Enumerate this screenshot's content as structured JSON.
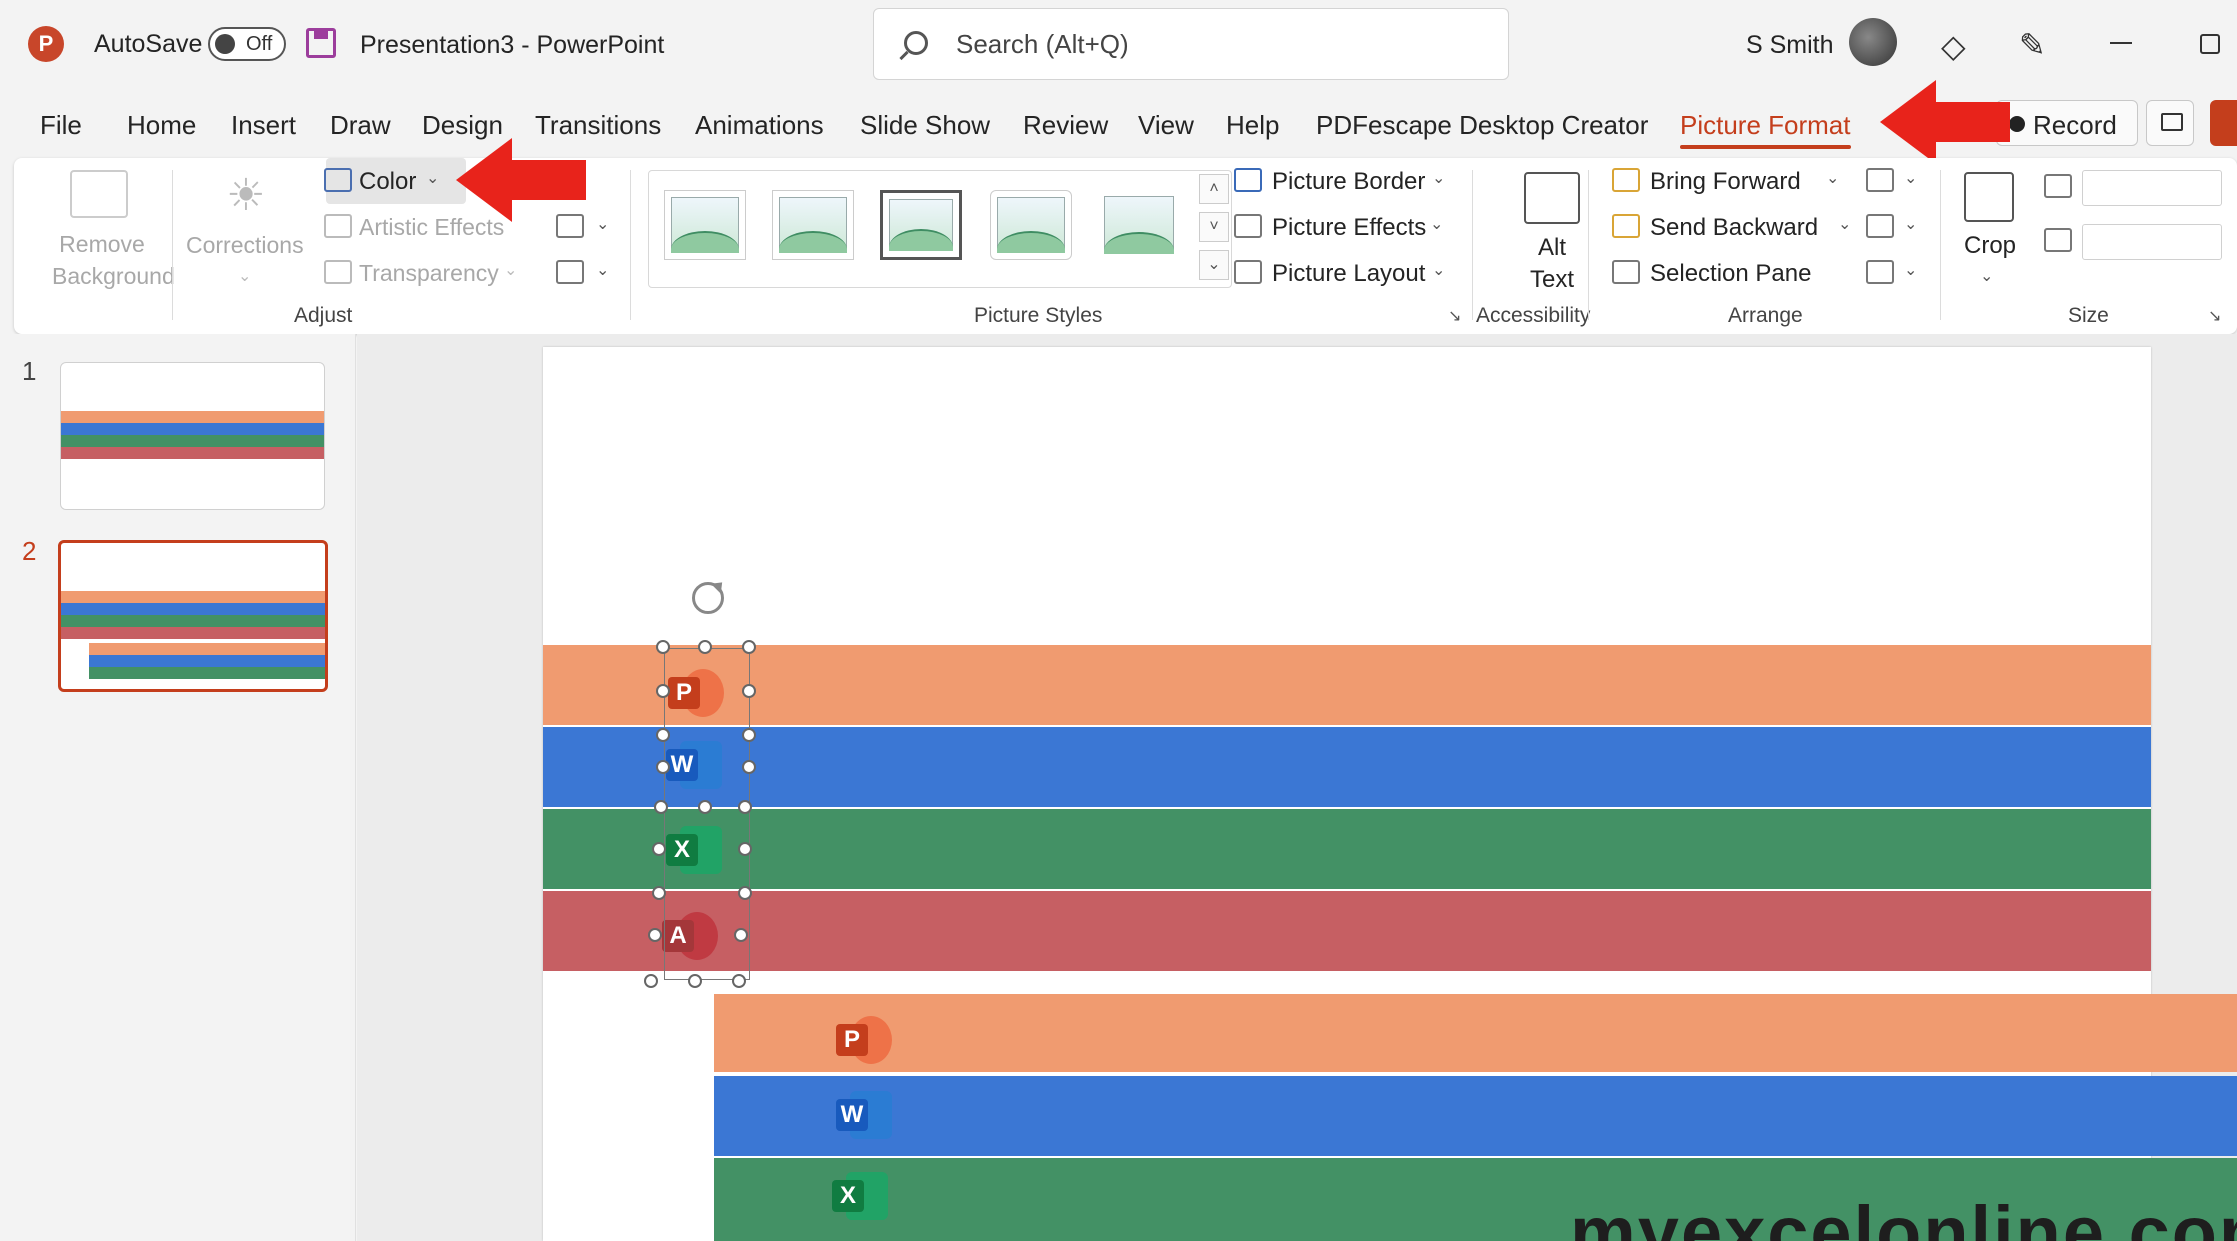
{
  "window": {
    "app_icon": "P",
    "autosave_label": "AutoSave",
    "autosave_state": "Off",
    "doc_title": "Presentation3  -  PowerPoint",
    "search_placeholder": "Search (Alt+Q)",
    "user_name": "S Smith"
  },
  "tabs": [
    {
      "label": "File"
    },
    {
      "label": "Home"
    },
    {
      "label": "Insert"
    },
    {
      "label": "Draw"
    },
    {
      "label": "Design"
    },
    {
      "label": "Transitions"
    },
    {
      "label": "Animations"
    },
    {
      "label": "Slide Show"
    },
    {
      "label": "Review"
    },
    {
      "label": "View"
    },
    {
      "label": "Help"
    },
    {
      "label": "PDFescape Desktop Creator"
    },
    {
      "label": "Picture Format",
      "active": true
    }
  ],
  "record_label": "Record",
  "ribbon": {
    "adjust": {
      "remove_background": "Remove Background",
      "corrections": "Corrections",
      "color": "Color",
      "artistic_effects": "Artistic Effects",
      "transparency": "Transparency",
      "group_label": "Adjust"
    },
    "picture_styles": {
      "picture_border": "Picture Border",
      "picture_effects": "Picture Effects",
      "picture_layout": "Picture Layout",
      "group_label": "Picture Styles"
    },
    "accessibility": {
      "alt_text": "Alt Text",
      "group_label": "Accessibility"
    },
    "arrange": {
      "bring_forward": "Bring Forward",
      "send_backward": "Send Backward",
      "selection_pane": "Selection Pane",
      "group_label": "Arrange"
    },
    "size": {
      "crop": "Crop",
      "group_label": "Size"
    }
  },
  "slides": [
    {
      "number": "1"
    },
    {
      "number": "2",
      "selected": true
    }
  ],
  "slide_content": {
    "logos_top": [
      "P",
      "W",
      "X",
      "A"
    ],
    "logos_bottom": [
      "P",
      "W",
      "X"
    ],
    "watermark": "myexcelonline.com"
  },
  "colors": {
    "accent": "#c43e1c",
    "band_orange": "#f09b70",
    "band_blue": "#3b77d4",
    "band_green": "#439165",
    "band_red": "#c65f63",
    "arrow_red": "#e8231b"
  },
  "icons": [
    "app-icon",
    "save-icon",
    "search-icon",
    "diamond-icon",
    "pen-icon",
    "minimize-icon",
    "restore-icon",
    "record-icon",
    "comment-icon",
    "share-icon",
    "rotate-handle-icon"
  ]
}
